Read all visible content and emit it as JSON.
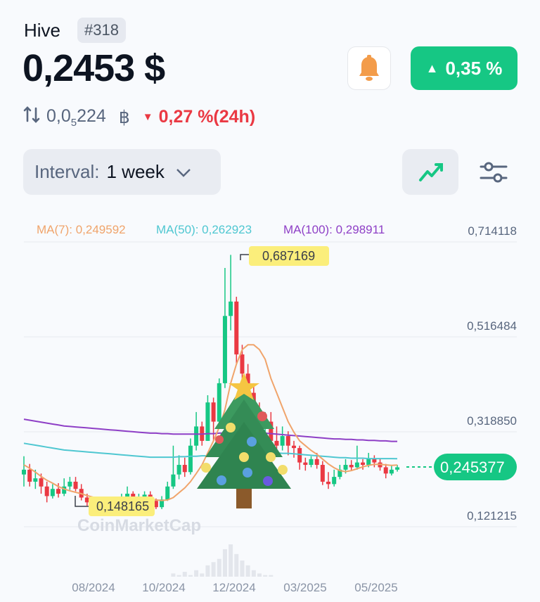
{
  "coin": {
    "name": "Hive",
    "rank": "#318",
    "price": "0,2453 $",
    "change_label": "0,35 %",
    "btc_prefix": "0,0",
    "btc_sub": "5",
    "btc_suffix": "224",
    "btc_symbol": "฿",
    "change24h": "0,27 %(24h)"
  },
  "controls": {
    "interval_label": "Interval:",
    "interval_value": "1 week",
    "bell_icon": "bell-icon",
    "line_icon": "line-chart-icon",
    "filter_icon": "sliders-icon"
  },
  "colors": {
    "up": "#16c784",
    "down": "#ea3943",
    "ma7": "#f0a46b",
    "ma50": "#4fc7d1",
    "ma100": "#8e3fc6",
    "bell": "#f39c4a"
  },
  "chart_data": {
    "type": "candlestick",
    "watermark": "CoinMarketCap",
    "legend": [
      {
        "label": "MA(7): 0,249592",
        "color": "#f0a46b"
      },
      {
        "label": "MA(50): 0,262923",
        "color": "#4fc7d1"
      },
      {
        "label": "MA(100): 0,298911",
        "color": "#8e3fc6"
      }
    ],
    "y_ticks": [
      "0,714118",
      "0,516484",
      "0,318850",
      "0,121215"
    ],
    "x_ticks": [
      "08/2024",
      "10/2024",
      "12/2024",
      "03/2025",
      "05/2025"
    ],
    "high_label": "0,687169",
    "low_label": "0,148165",
    "current_label": "0,245377",
    "ylim": [
      0.121215,
      0.714118
    ],
    "candles": [
      [
        0.23,
        0.24,
        0.268,
        0.205
      ],
      [
        0.24,
        0.215,
        0.252,
        0.205
      ],
      [
        0.215,
        0.222,
        0.24,
        0.2
      ],
      [
        0.222,
        0.205,
        0.232,
        0.19
      ],
      [
        0.205,
        0.185,
        0.215,
        0.172
      ],
      [
        0.185,
        0.2,
        0.21,
        0.18
      ],
      [
        0.2,
        0.19,
        0.212,
        0.182
      ],
      [
        0.19,
        0.205,
        0.222,
        0.185
      ],
      [
        0.205,
        0.215,
        0.225,
        0.198
      ],
      [
        0.215,
        0.2,
        0.225,
        0.195
      ],
      [
        0.2,
        0.182,
        0.21,
        0.176
      ],
      [
        0.182,
        0.172,
        0.19,
        0.165
      ],
      [
        0.172,
        0.165,
        0.182,
        0.158
      ],
      [
        0.165,
        0.16,
        0.175,
        0.15
      ],
      [
        0.16,
        0.158,
        0.168,
        0.148
      ],
      [
        0.158,
        0.17,
        0.176,
        0.15
      ],
      [
        0.17,
        0.162,
        0.178,
        0.155
      ],
      [
        0.162,
        0.175,
        0.19,
        0.16
      ],
      [
        0.175,
        0.19,
        0.205,
        0.17
      ],
      [
        0.19,
        0.178,
        0.195,
        0.17
      ],
      [
        0.178,
        0.18,
        0.19,
        0.172
      ],
      [
        0.18,
        0.188,
        0.195,
        0.175
      ],
      [
        0.188,
        0.175,
        0.195,
        0.17
      ],
      [
        0.175,
        0.162,
        0.18,
        0.158
      ],
      [
        0.162,
        0.178,
        0.185,
        0.158
      ],
      [
        0.178,
        0.205,
        0.215,
        0.175
      ],
      [
        0.205,
        0.23,
        0.29,
        0.2
      ],
      [
        0.23,
        0.25,
        0.27,
        0.22
      ],
      [
        0.25,
        0.235,
        0.265,
        0.225
      ],
      [
        0.235,
        0.29,
        0.305,
        0.23
      ],
      [
        0.29,
        0.33,
        0.36,
        0.28
      ],
      [
        0.33,
        0.3,
        0.34,
        0.29
      ],
      [
        0.3,
        0.38,
        0.395,
        0.3
      ],
      [
        0.38,
        0.34,
        0.39,
        0.3
      ],
      [
        0.34,
        0.42,
        0.43,
        0.33
      ],
      [
        0.42,
        0.56,
        0.66,
        0.41
      ],
      [
        0.56,
        0.59,
        0.687169,
        0.53
      ],
      [
        0.59,
        0.48,
        0.6,
        0.46
      ],
      [
        0.48,
        0.44,
        0.5,
        0.4
      ],
      [
        0.44,
        0.4,
        0.46,
        0.38
      ],
      [
        0.4,
        0.34,
        0.42,
        0.32
      ],
      [
        0.34,
        0.33,
        0.38,
        0.3
      ],
      [
        0.33,
        0.34,
        0.36,
        0.31
      ],
      [
        0.34,
        0.3,
        0.36,
        0.28
      ],
      [
        0.3,
        0.29,
        0.33,
        0.27
      ],
      [
        0.29,
        0.31,
        0.33,
        0.28
      ],
      [
        0.31,
        0.29,
        0.32,
        0.27
      ],
      [
        0.29,
        0.285,
        0.3,
        0.265
      ],
      [
        0.285,
        0.255,
        0.29,
        0.24
      ],
      [
        0.255,
        0.25,
        0.265,
        0.238
      ],
      [
        0.25,
        0.262,
        0.268,
        0.245
      ],
      [
        0.262,
        0.25,
        0.275,
        0.242
      ],
      [
        0.25,
        0.215,
        0.258,
        0.208
      ],
      [
        0.215,
        0.21,
        0.235,
        0.2
      ],
      [
        0.21,
        0.225,
        0.24,
        0.205
      ],
      [
        0.225,
        0.24,
        0.25,
        0.22
      ],
      [
        0.24,
        0.25,
        0.262,
        0.232
      ],
      [
        0.25,
        0.245,
        0.26,
        0.238
      ],
      [
        0.245,
        0.255,
        0.29,
        0.24
      ],
      [
        0.255,
        0.25,
        0.262,
        0.24
      ],
      [
        0.25,
        0.262,
        0.275,
        0.245
      ],
      [
        0.262,
        0.255,
        0.27,
        0.245
      ],
      [
        0.255,
        0.245,
        0.262,
        0.238
      ],
      [
        0.245,
        0.232,
        0.252,
        0.222
      ],
      [
        0.232,
        0.24,
        0.248,
        0.228
      ],
      [
        0.24,
        0.245,
        0.25,
        0.236
      ]
    ],
    "ma7": [
      0.25,
      0.243,
      0.235,
      0.226,
      0.218,
      0.212,
      0.205,
      0.2,
      0.196,
      0.193,
      0.19,
      0.186,
      0.183,
      0.18,
      0.177,
      0.175,
      0.173,
      0.172,
      0.172,
      0.173,
      0.174,
      0.176,
      0.177,
      0.177,
      0.176,
      0.177,
      0.182,
      0.192,
      0.202,
      0.215,
      0.232,
      0.25,
      0.275,
      0.3,
      0.328,
      0.365,
      0.42,
      0.46,
      0.49,
      0.5,
      0.5,
      0.49,
      0.47,
      0.43,
      0.4,
      0.37,
      0.34,
      0.318,
      0.3,
      0.29,
      0.28,
      0.272,
      0.262,
      0.252,
      0.244,
      0.238,
      0.236,
      0.238,
      0.242,
      0.246,
      0.249,
      0.251,
      0.251,
      0.25,
      0.249,
      0.2496
    ],
    "ma50": [
      0.295,
      0.293,
      0.291,
      0.289,
      0.287,
      0.285,
      0.283,
      0.281,
      0.28,
      0.279,
      0.278,
      0.277,
      0.276,
      0.275,
      0.274,
      0.273,
      0.272,
      0.271,
      0.27,
      0.269,
      0.268,
      0.267,
      0.266,
      0.266,
      0.266,
      0.266,
      0.266,
      0.267,
      0.267,
      0.268,
      0.268,
      0.269,
      0.269,
      0.27,
      0.27,
      0.271,
      0.272,
      0.273,
      0.273,
      0.274,
      0.274,
      0.275,
      0.275,
      0.275,
      0.275,
      0.274,
      0.274,
      0.273,
      0.272,
      0.271,
      0.27,
      0.269,
      0.268,
      0.267,
      0.266,
      0.265,
      0.265,
      0.264,
      0.264,
      0.264,
      0.263,
      0.263,
      0.263,
      0.263,
      0.263,
      0.2629
    ],
    "ma100": [
      0.345,
      0.343,
      0.341,
      0.339,
      0.337,
      0.335,
      0.333,
      0.331,
      0.33,
      0.329,
      0.328,
      0.327,
      0.326,
      0.325,
      0.324,
      0.323,
      0.322,
      0.321,
      0.32,
      0.319,
      0.318,
      0.317,
      0.316,
      0.316,
      0.315,
      0.315,
      0.314,
      0.314,
      0.314,
      0.314,
      0.314,
      0.314,
      0.315,
      0.315,
      0.316,
      0.316,
      0.317,
      0.317,
      0.317,
      0.317,
      0.317,
      0.316,
      0.316,
      0.315,
      0.314,
      0.313,
      0.312,
      0.311,
      0.31,
      0.309,
      0.308,
      0.307,
      0.306,
      0.305,
      0.304,
      0.304,
      0.303,
      0.303,
      0.302,
      0.302,
      0.301,
      0.301,
      0.3,
      0.3,
      0.299,
      0.2989
    ],
    "volume": [
      0,
      0,
      0,
      0,
      0,
      0,
      0,
      0,
      0,
      0,
      0,
      0,
      0,
      0,
      0,
      0,
      0,
      0,
      0,
      0,
      0,
      0,
      0,
      0,
      0,
      0,
      0.1,
      0.05,
      0.15,
      0.05,
      0.2,
      0.1,
      0.35,
      0.45,
      0.55,
      0.85,
      1.0,
      0.7,
      0.5,
      0.35,
      0.2,
      0.1,
      0.05,
      0.05,
      0,
      0,
      0,
      0,
      0,
      0,
      0,
      0,
      0,
      0,
      0,
      0,
      0,
      0,
      0,
      0,
      0,
      0,
      0,
      0,
      0,
      0
    ]
  }
}
